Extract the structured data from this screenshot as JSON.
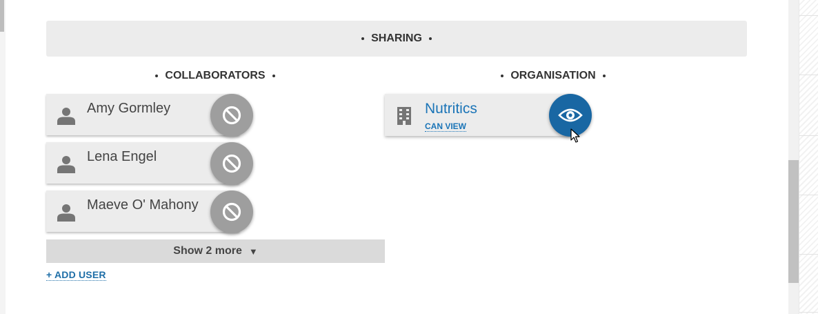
{
  "sharing": {
    "title": "SHARING"
  },
  "collaborators": {
    "title": "COLLABORATORS",
    "users": [
      {
        "name": "Amy Gormley"
      },
      {
        "name": "Lena Engel"
      },
      {
        "name": "Maeve O' Mahony"
      }
    ],
    "show_more_label": "Show 2 more",
    "show_more_arrow": "▼",
    "add_user_label": "+ ADD USER"
  },
  "organisation": {
    "title": "ORGANISATION",
    "name": "Nutritics",
    "permission": "CAN VIEW"
  },
  "icons": {
    "user": "person-icon",
    "remove": "block-icon",
    "organisation": "building-icon",
    "view": "eye-icon"
  },
  "colors": {
    "accent": "#1967a3",
    "link": "#1a74b7",
    "remove_button": "#9e9e9e",
    "panel_bg": "#ececec"
  }
}
